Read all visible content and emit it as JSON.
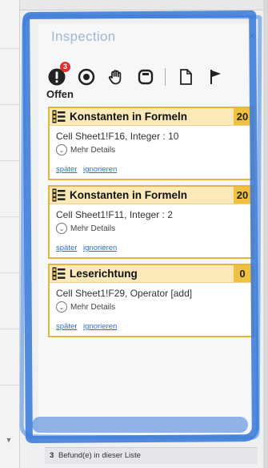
{
  "pane": {
    "title": "Inspection",
    "close_icon": "close-icon"
  },
  "toolbar": {
    "items": [
      {
        "name": "errors-filter",
        "icon": "exclamation-icon",
        "badge": "3"
      },
      {
        "name": "pending-filter",
        "icon": "target-icon"
      },
      {
        "name": "ignored-filter",
        "icon": "hand-icon"
      },
      {
        "name": "rounded-square-filter",
        "icon": "square-icon"
      },
      {
        "name": "document-filter",
        "icon": "document-icon"
      },
      {
        "name": "flag-filter",
        "icon": "flag-icon"
      }
    ]
  },
  "section": {
    "label": "Offen"
  },
  "findings": [
    {
      "title": "Konstanten in Formeln",
      "count": "20",
      "cell": "Cell Sheet1!F16, Integer : 10",
      "details": "Mehr Details",
      "later": "später",
      "ignore": "ignorieren"
    },
    {
      "title": "Konstanten in Formeln",
      "count": "20",
      "cell": "Cell Sheet1!F11, Integer : 2",
      "details": "Mehr Details",
      "later": "später",
      "ignore": "ignorieren"
    },
    {
      "title": "Leserichtung",
      "count": "0",
      "cell": "Cell Sheet1!F29, Operator [add]",
      "details": "Mehr Details",
      "later": "später",
      "ignore": "ignorieren"
    }
  ],
  "status": {
    "count": "3",
    "text": "Befund(e) in dieser Liste"
  },
  "colors": {
    "accent": "#e5b43a",
    "header_bg": "#fbe9b9",
    "link": "#2a6fd1",
    "annotation_blue": "#3b7bd8",
    "badge": "#e03030"
  }
}
